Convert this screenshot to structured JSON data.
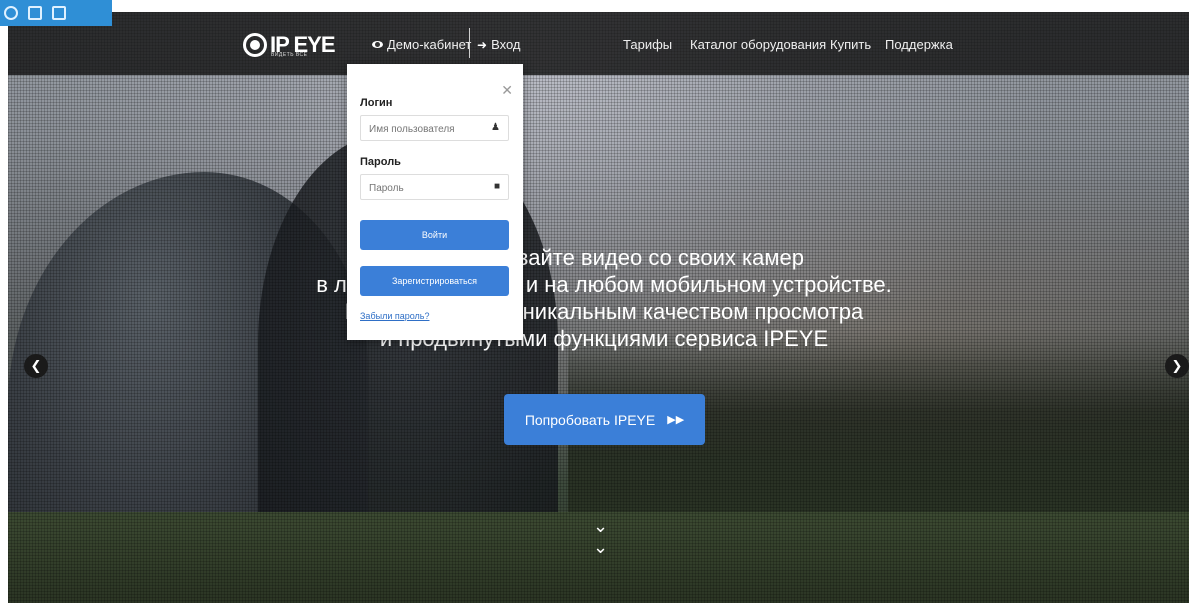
{
  "colors": {
    "accent": "#3b7fd8",
    "navbar_bg": "#141414",
    "link": "#2f6fc6"
  },
  "app_icons": [
    "app-icon-1",
    "app-icon-2",
    "app-icon-3"
  ],
  "nav": {
    "logo_text": "IP EYE",
    "logo_sub": "ВИДЕТЬ ВСЕ",
    "demo_label": "Демо-кабинет",
    "login_label": "Вход",
    "items": [
      "Тарифы",
      "Каталог оборудования",
      "Купить",
      "Поддержка"
    ]
  },
  "hero": {
    "lines": [
      "Просматривайте видео со своих камер",
      "в любой точке мира и на любом мобильном устройстве.",
      "Наслаждайтесь уникальным качеством просмотра",
      "и продвинутыми функциями сервиса IPEYE"
    ],
    "cta_label": "Попробовать IPEYE",
    "cta_icon": "fast-forward-icon",
    "prev_icon": "chevron-left-icon",
    "next_icon": "chevron-right-icon",
    "scroll_icon": "double-chevron-down-icon"
  },
  "login_popup": {
    "login_label": "Логин",
    "login_placeholder": "Имя пользователя",
    "password_label": "Пароль",
    "password_placeholder": "Пароль",
    "submit_label": "Войти",
    "register_label": "Зарегистрироваться",
    "forgot_label": "Забыли пароль?"
  }
}
